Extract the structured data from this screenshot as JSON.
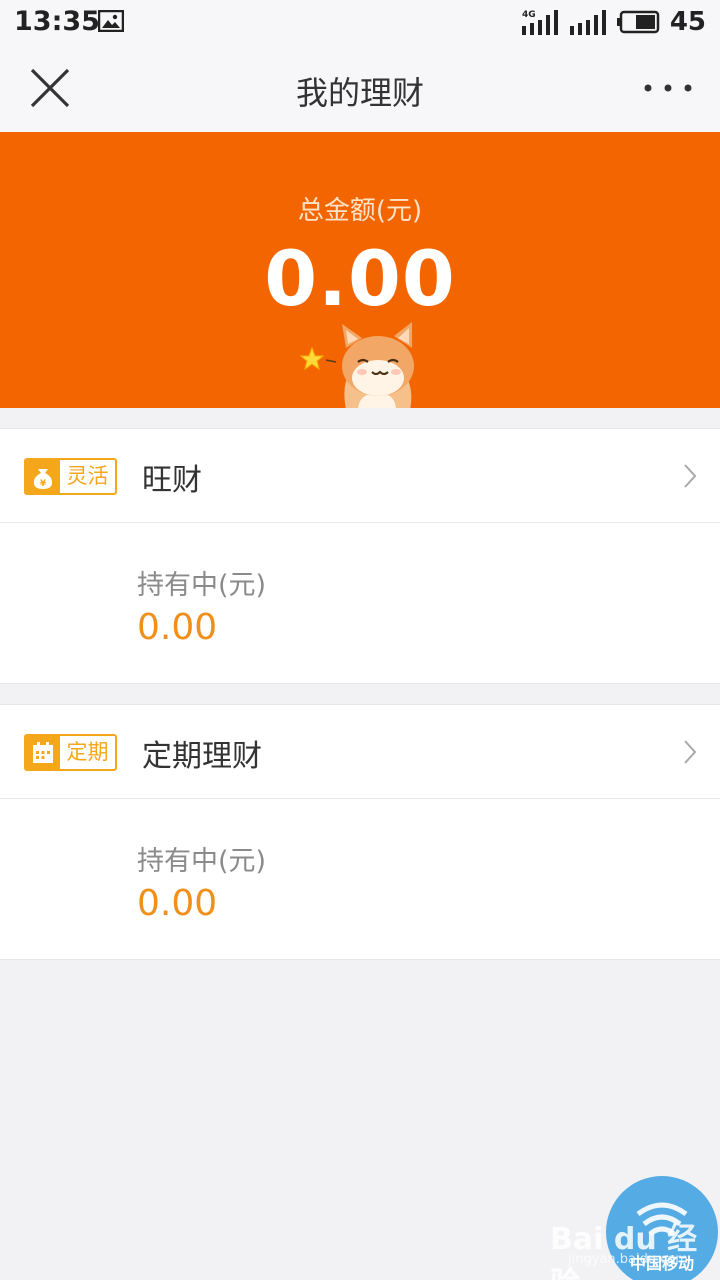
{
  "status_bar": {
    "time": "13:35",
    "network": "4G",
    "battery": "45",
    "icons": [
      "gallery-icon",
      "signal-4g-icon",
      "signal-icon",
      "battery-icon"
    ]
  },
  "nav": {
    "title": "我的理财",
    "close_icon": "close-icon",
    "more_icon": "more-icon"
  },
  "summary": {
    "label": "总金额(元)",
    "amount": "0.00",
    "mascot": "shiba-dog-mascot"
  },
  "products": [
    {
      "tag_icon": "money-bag-icon",
      "tag": "灵活",
      "name": "旺财",
      "hold_label": "持有中(元)",
      "hold_value": "0.00"
    },
    {
      "tag_icon": "calendar-icon",
      "tag": "定期",
      "name": "定期理财",
      "hold_label": "持有中(元)",
      "hold_value": "0.00"
    }
  ],
  "watermark": {
    "text": "Bai du 经验",
    "sub": "jingyan.baidu.com",
    "brand": "中国移动"
  },
  "colors": {
    "banner": "#f36500",
    "accent": "#f5a71b",
    "value": "#f08f1a",
    "background": "#f2f1f4"
  }
}
